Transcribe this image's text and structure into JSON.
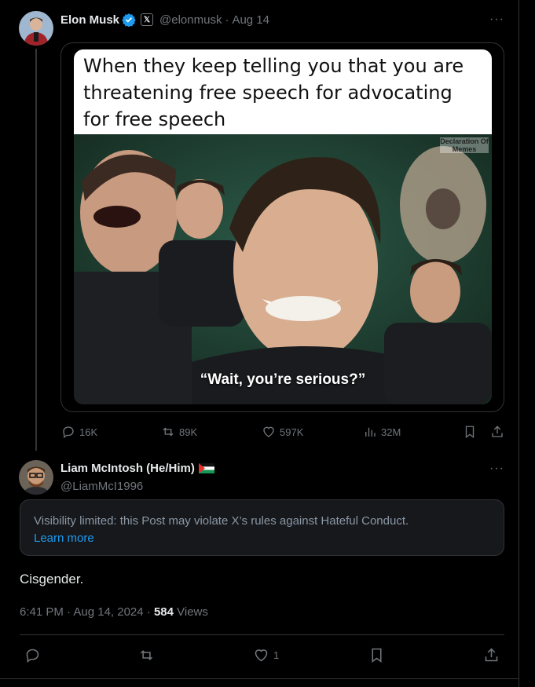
{
  "colors": {
    "background": "#000000",
    "text": "#e7e9ea",
    "muted": "#71767b",
    "accent": "#1d9bf0",
    "notice_bg": "#16181c"
  },
  "parent_tweet": {
    "author_name": "Elon Musk",
    "handle": "@elonmusk",
    "separator": "·",
    "date": "Aug 14",
    "more": "···",
    "media": {
      "meme_text": "When they keep telling you that you are threatening free speech for advocating for free speech",
      "caption": "“Wait, you’re serious?”",
      "watermark": "Declaration Of Memes"
    },
    "actions": {
      "replies": "16K",
      "reposts": "89K",
      "likes": "597K",
      "views": "32M"
    }
  },
  "reply_tweet": {
    "author_name": "Liam McIntosh (He/Him)",
    "handle": "@LiamMcI1996",
    "more": "···",
    "notice_text": "Visibility limited: this Post may violate X’s rules against Hateful Conduct.",
    "notice_link": "Learn more",
    "body": "Cisgender.",
    "timestamp": "6:41 PM · Aug 14, 2024 · ",
    "views_count": "584",
    "views_label": " Views",
    "actions": {
      "likes": "1"
    }
  }
}
